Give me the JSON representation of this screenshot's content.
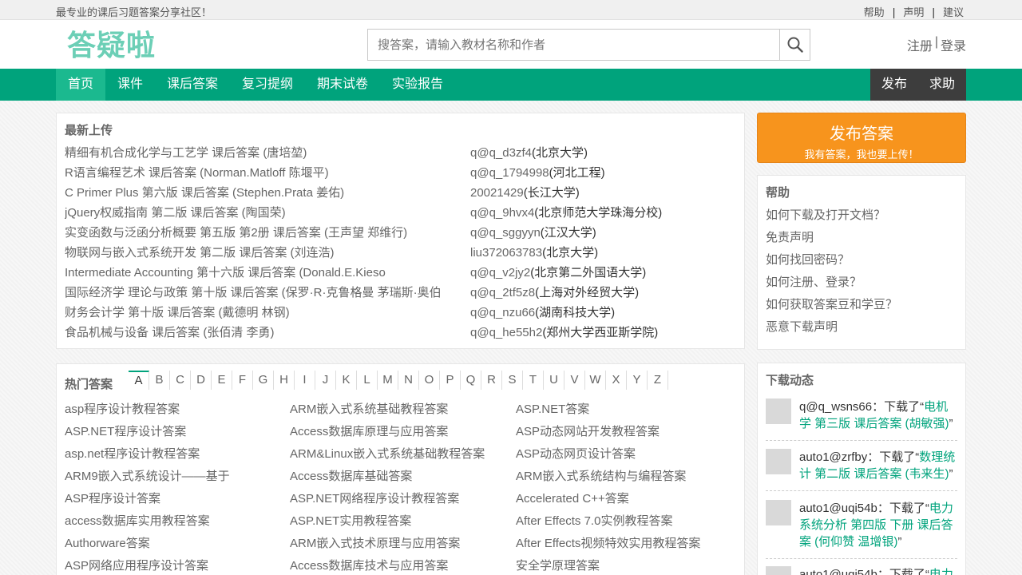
{
  "topbar": {
    "slogan": "最专业的课后习题答案分享社区！",
    "links": [
      "帮助",
      "声明",
      "建议"
    ]
  },
  "header": {
    "logo_text": "答疑啦",
    "search_placeholder": "搜答案，请输入教材名称和作者",
    "register": "注册",
    "login_sep": "|",
    "login": "登录"
  },
  "nav": {
    "items": [
      "首页",
      "课件",
      "课后答案",
      "复习提纲",
      "期末试卷",
      "实验报告"
    ],
    "right": [
      "发布",
      "求助"
    ]
  },
  "latest": {
    "title": "最新上传",
    "rows": [
      {
        "book": "精细有机合成化学与工艺学 课后答案 (唐培堃)",
        "user": "q@q_d3zf4",
        "school": "(北京大学)"
      },
      {
        "book": "R语言编程艺术 课后答案 (Norman.Matloff 陈堰平)",
        "user": "q@q_1794998",
        "school": "(河北工程)"
      },
      {
        "book": "C Primer Plus 第六版 课后答案 (Stephen.Prata 姜佑)",
        "user": "20021429",
        "school": "(长江大学)"
      },
      {
        "book": "jQuery权威指南 第二版 课后答案 (陶国荣)",
        "user": "q@q_9hvx4",
        "school": "(北京师范大学珠海分校)"
      },
      {
        "book": "实变函数与泛函分析概要 第五版 第2册 课后答案 (王声望 郑维行)",
        "user": "q@q_sggyyn",
        "school": "(江汉大学)"
      },
      {
        "book": "物联网与嵌入式系统开发 第二版 课后答案 (刘连浩)",
        "user": "liu372063783",
        "school": "(北京大学)"
      },
      {
        "book": "Intermediate Accounting 第十六版 课后答案 (Donald.E.Kieso",
        "user": "q@q_v2jy2",
        "school": "(北京第二外国语大学)"
      },
      {
        "book": "国际经济学 理论与政策 第十版 课后答案 (保罗·R·克鲁格曼 茅瑞斯·奥伯",
        "user": "q@q_2tf5z8",
        "school": "(上海对外经贸大学)"
      },
      {
        "book": "财务会计学 第十版 课后答案 (戴德明 林钢)",
        "user": "q@q_nzu66",
        "school": "(湖南科技大学)"
      },
      {
        "book": "食品机械与设备 课后答案 (张佰清 李勇)",
        "user": "q@q_he55h2",
        "school": "(郑州大学西亚斯学院)"
      }
    ]
  },
  "hot": {
    "title": "热门答案",
    "letters": [
      "A",
      "B",
      "C",
      "D",
      "E",
      "F",
      "G",
      "H",
      "I",
      "J",
      "K",
      "L",
      "M",
      "N",
      "O",
      "P",
      "Q",
      "R",
      "S",
      "T",
      "U",
      "V",
      "W",
      "X",
      "Y",
      "Z"
    ],
    "active_letter": "A",
    "columns": [
      [
        "asp程序设计教程答案",
        "ASP.NET程序设计答案",
        "asp.net程序设计教程答案",
        "ARM9嵌入式系统设计——基于",
        "ASP程序设计答案",
        "access数据库实用教程答案",
        "Authorware答案",
        "ASP网络应用程序设计答案"
      ],
      [
        "ARM嵌入式系统基础教程答案",
        "Access数据库原理与应用答案",
        "ARM&Linux嵌入式系统基础教程答案",
        "Access数据库基础答案",
        "ASP.NET网络程序设计教程答案",
        "ASP.NET实用教程答案",
        "ARM嵌入式技术原理与应用答案",
        "Access数据库技术与应用答案"
      ],
      [
        "ASP.NET答案",
        "ASP动态网站开发教程答案",
        "ASP动态网页设计答案",
        "ARM嵌入式系统结构与编程答案",
        "Accelerated C++答案",
        "After Effects 7.0实例教程答案",
        "After Effects视频特效实用教程答案",
        "安全学原理答案"
      ]
    ]
  },
  "publish": {
    "title": "发布答案",
    "subtitle": "我有答案，我也要上传！"
  },
  "help": {
    "title": "帮助",
    "links": [
      "如何下载及打开文档？",
      "免责声明",
      "如何找回密码？",
      "如何注册、登录？",
      "如何获取答案豆和学豆？",
      "恶意下载声明"
    ]
  },
  "downloads": {
    "title": "下载动态",
    "items": [
      {
        "user": "q@q_wsns66",
        "action": "：下载了“",
        "book": "电机学 第三版 课后答案 (胡敏强)",
        "close": "”"
      },
      {
        "user": "auto1@zrfby",
        "action": "：下载了“",
        "book": "数理统计 第二版 课后答案 (韦来生)",
        "close": "”"
      },
      {
        "user": "auto1@uqi54b",
        "action": "：下载了“",
        "book": "电力系统分析 第四版 下册 课后答案 (何仰赞 温增银)",
        "close": "”"
      },
      {
        "user": "auto1@uqi54b",
        "action": "：下载了“",
        "book": "电力",
        "close": ""
      }
    ]
  },
  "colors": {
    "brand": "#00a37c",
    "nav_active": "#1bb98f",
    "nav_dark": "#3d3d3d",
    "publish": "#f7941d"
  }
}
